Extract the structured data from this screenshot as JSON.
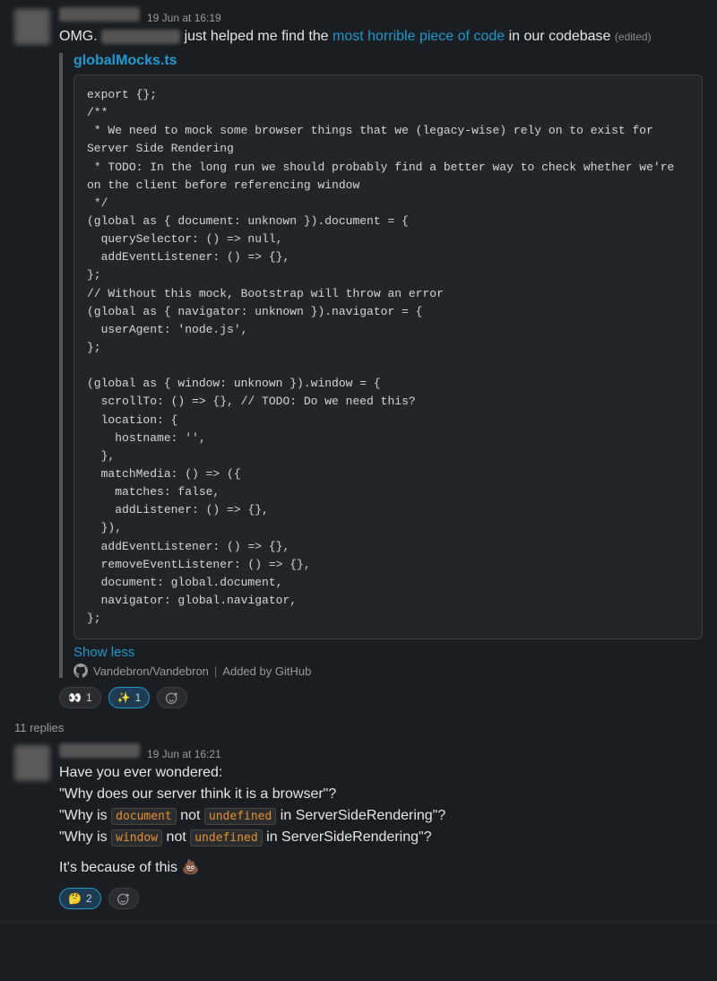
{
  "message1": {
    "timestamp": "19 Jun at 16:19",
    "text_prefix": "OMG.",
    "text_mid": "just helped me find the",
    "link_text": "most horrible piece of code",
    "text_suffix": "in our codebase",
    "edited": "(edited)",
    "attachment": {
      "file_title": "globalMocks.ts",
      "code": "export {};\n/**\n * We need to mock some browser things that we (legacy-wise) rely on to exist for Server Side Rendering\n * TODO: In the long run we should probably find a better way to check whether we're on the client before referencing window\n */\n(global as { document: unknown }).document = {\n  querySelector: () => null,\n  addEventListener: () => {},\n};\n// Without this mock, Bootstrap will throw an error\n(global as { navigator: unknown }).navigator = {\n  userAgent: 'node.js',\n};\n\n(global as { window: unknown }).window = {\n  scrollTo: () => {}, // TODO: Do we need this?\n  location: {\n    hostname: '',\n  },\n  matchMedia: () => ({\n    matches: false,\n    addListener: () => {},\n  }),\n  addEventListener: () => {},\n  removeEventListener: () => {},\n  document: global.document,\n  navigator: global.navigator,\n};",
      "show_less": "Show less",
      "source_repo": "Vandebron/Vandebron",
      "source_sep": "|",
      "source_added": "Added by GitHub"
    },
    "reactions": [
      {
        "emoji": "👀",
        "count": "1",
        "name": "eyes-reaction"
      },
      {
        "emoji": "✨",
        "count": "1",
        "name": "sparkles-reaction"
      }
    ]
  },
  "thread": {
    "replies": "11 replies"
  },
  "message2": {
    "timestamp": "19 Jun at 16:21",
    "line1": "Have you ever wondered:",
    "line2_pre": "\"Why does our server think it is a browser\"?",
    "line3_pre": "\"Why is ",
    "line3_code": "document",
    "line3_mid": " not ",
    "line3_code2": "undefined",
    "line3_suf": " in ServerSideRendering\"?",
    "line4_pre": "\"Why is ",
    "line4_code": "window",
    "line4_mid": " not ",
    "line4_code2": "undefined",
    "line4_suf": " in ServerSideRendering\"?",
    "line5_pre": "It's because of this ",
    "line5_emoji": "💩",
    "reactions": [
      {
        "emoji": "🤔",
        "count": "2",
        "name": "thinking-reaction"
      }
    ]
  }
}
